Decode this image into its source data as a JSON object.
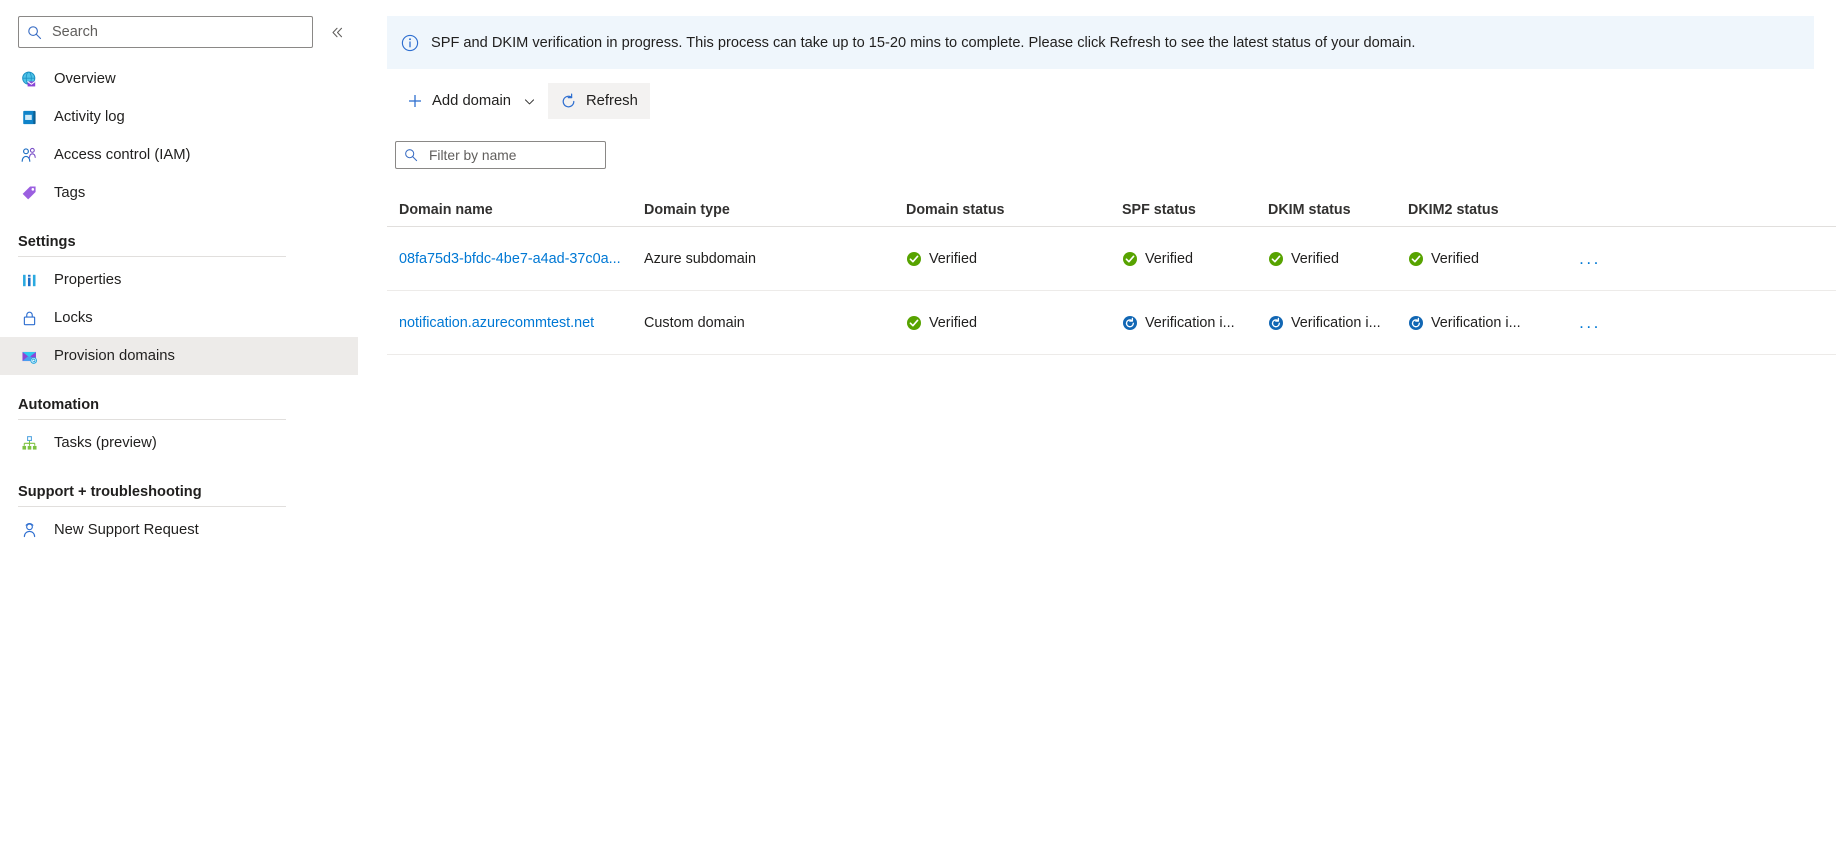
{
  "sidebar": {
    "search": {
      "placeholder": "Search",
      "value": "",
      "icon": "search-icon"
    },
    "collapse_icon": "chevron-double-left-icon",
    "items": [
      {
        "label": "Overview",
        "icon": "overview-globe-mail-icon",
        "selected": false
      },
      {
        "label": "Activity log",
        "icon": "activity-log-icon",
        "selected": false
      },
      {
        "label": "Access control (IAM)",
        "icon": "access-control-people-icon",
        "selected": false
      },
      {
        "label": "Tags",
        "icon": "tags-icon",
        "selected": false
      }
    ],
    "groups": [
      {
        "title": "Settings",
        "items": [
          {
            "label": "Properties",
            "icon": "properties-bars-icon",
            "selected": false
          },
          {
            "label": "Locks",
            "icon": "lock-icon",
            "selected": false
          },
          {
            "label": "Provision domains",
            "icon": "provision-domains-mail-icon",
            "selected": true
          }
        ]
      },
      {
        "title": "Automation",
        "items": [
          {
            "label": "Tasks (preview)",
            "icon": "tasks-hierarchy-icon",
            "selected": false
          }
        ]
      },
      {
        "title": "Support + troubleshooting",
        "items": [
          {
            "label": "New Support Request",
            "icon": "support-person-icon",
            "selected": false
          }
        ]
      }
    ]
  },
  "banner": {
    "icon": "info-circle-icon",
    "message": "SPF and DKIM verification in progress. This process can take up to 15-20 mins to complete. Please click Refresh to see the latest status of your domain.",
    "background": "#eff6fc",
    "icon_color": "#0078d4"
  },
  "toolbar": {
    "add_domain_label": "Add domain",
    "add_domain_icon": "plus-icon",
    "add_domain_chevron_icon": "chevron-down-icon",
    "refresh_label": "Refresh",
    "refresh_icon": "refresh-icon",
    "refresh_active": true
  },
  "filter": {
    "placeholder": "Filter by name",
    "value": "",
    "icon": "search-icon"
  },
  "table": {
    "columns": [
      "Domain name",
      "Domain type",
      "Domain status",
      "SPF status",
      "DKIM status",
      "DKIM2 status"
    ],
    "row_menu_icon": "ellipsis-icon",
    "rows": [
      {
        "domain_name": "08fa75d3-bfdc-4be7-a4ad-37c0a...",
        "domain_type": "Azure subdomain",
        "domain_status": "Verified",
        "domain_status_icon": "check-circle-green-icon",
        "spf_status": "Verified",
        "spf_status_icon": "check-circle-green-icon",
        "dkim_status": "Verified",
        "dkim_status_icon": "check-circle-green-icon",
        "dkim2_status": "Verified",
        "dkim2_status_icon": "check-circle-green-icon",
        "menu": "..."
      },
      {
        "domain_name": "notification.azurecommtest.net",
        "domain_type": "Custom domain",
        "domain_status": "Verified",
        "domain_status_icon": "check-circle-green-icon",
        "spf_status": "Verification i...",
        "spf_status_icon": "in-progress-blue-icon",
        "dkim_status": "Verification i...",
        "dkim_status_icon": "in-progress-blue-icon",
        "dkim2_status": "Verification i...",
        "dkim2_status_icon": "in-progress-blue-icon",
        "menu": "..."
      }
    ]
  },
  "colors": {
    "link": "#0078d4",
    "success": "#57a300",
    "in_progress": "#0078d4",
    "selected_row": "#edebe9"
  }
}
